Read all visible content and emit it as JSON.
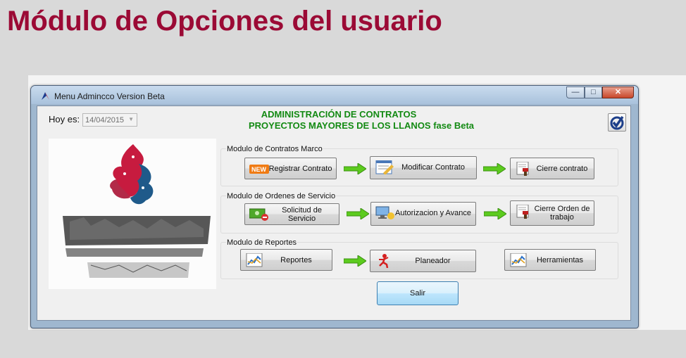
{
  "slide": {
    "title": "Módulo de Opciones del usuario"
  },
  "window": {
    "title": "Menu Admincco Version Beta",
    "controls": {
      "minimize": "—",
      "maximize": "□",
      "close": "✕"
    }
  },
  "header": {
    "date_label": "Hoy es:",
    "date_value": "14/04/2015",
    "line1": "ADMINISTRACIÓN DE CONTRATOS",
    "line2": "PROYECTOS MAYORES DE LOS LLANOS fase Beta"
  },
  "groups": [
    {
      "label": "Modulo de Contratos Marco",
      "buttons": [
        {
          "label": "Registrar Contrato",
          "icon": "new-badge-icon"
        },
        {
          "label": "Modificar Contrato",
          "icon": "edit-document-icon"
        },
        {
          "label": "Cierre contrato",
          "icon": "stamp-document-icon"
        }
      ]
    },
    {
      "label": "Modulo de Ordenes de Servicio",
      "buttons": [
        {
          "label": "Solicitud de Servicio",
          "icon": "money-request-icon"
        },
        {
          "label": "Autorizacion y Avance",
          "icon": "computer-authorize-icon"
        },
        {
          "label": "Cierre Orden de trabajo",
          "icon": "stamp-document-icon"
        }
      ]
    },
    {
      "label": "Modulo de Reportes",
      "buttons": [
        {
          "label": "Reportes",
          "icon": "chart-report-icon"
        },
        {
          "label": "Planeador",
          "icon": "runner-icon"
        },
        {
          "label": "Herramientas",
          "icon": "chart-tools-icon"
        }
      ]
    }
  ],
  "exit_button": "Salir",
  "colors": {
    "title": "#9b0a35",
    "header_text": "#138a13",
    "arrow": "#5ccb1e"
  }
}
